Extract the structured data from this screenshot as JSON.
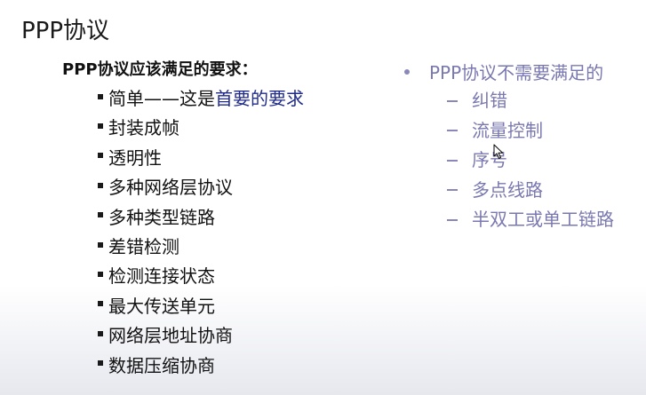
{
  "slide": {
    "title": "PPP协议",
    "requirements": {
      "heading": "PPP协议应该满足的要求：",
      "first_item": {
        "prefix": "简单——这是",
        "highlight": "首要的要求"
      },
      "items": [
        "封装成帧",
        "透明性",
        "多种网络层协议",
        "多种类型链路",
        "差错检测",
        "检测连接状态",
        "最大传送单元",
        "网络层地址协商",
        "数据压缩协商"
      ]
    },
    "not_required": {
      "heading": "PPP协议不需要满足的",
      "items": [
        "纠错",
        "流量控制",
        "序号",
        "多点线路",
        "半双工或单工链路"
      ]
    }
  },
  "colors": {
    "highlight": "#1f2a8a",
    "muted_purple": "#7a78b0"
  },
  "icons": {
    "cursor": "mouse-pointer-icon"
  }
}
